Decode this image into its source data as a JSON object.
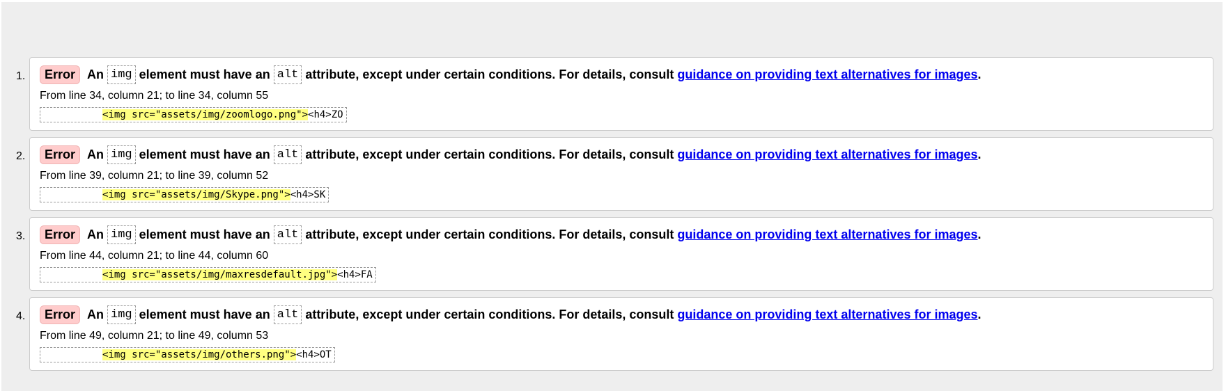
{
  "errors": [
    {
      "number": "1.",
      "badge": "Error",
      "t1": "An",
      "code1": "img",
      "t2": "element must have an",
      "code2": "alt",
      "t3": "attribute, except under certain conditions. For details, consult",
      "link": "guidance on providing text alternatives for images",
      "t4": ".",
      "location": "From line 34, column 21; to line 34, column 55",
      "highlight": "<img src=\"assets/img/zoomlogo.png\">",
      "after": "<h4>ZO"
    },
    {
      "number": "2.",
      "badge": "Error",
      "t1": "An",
      "code1": "img",
      "t2": "element must have an",
      "code2": "alt",
      "t3": "attribute, except under certain conditions. For details, consult",
      "link": "guidance on providing text alternatives for images",
      "t4": ".",
      "location": "From line 39, column 21; to line 39, column 52",
      "highlight": "<img src=\"assets/img/Skype.png\">",
      "after": "<h4>SK"
    },
    {
      "number": "3.",
      "badge": "Error",
      "t1": "An",
      "code1": "img",
      "t2": "element must have an",
      "code2": "alt",
      "t3": "attribute, except under certain conditions. For details, consult",
      "link": "guidance on providing text alternatives for images",
      "t4": ".",
      "location": "From line 44, column 21; to line 44, column 60",
      "highlight": "<img src=\"assets/img/maxresdefault.jpg\">",
      "after": "<h4>FA"
    },
    {
      "number": "4.",
      "badge": "Error",
      "t1": "An",
      "code1": "img",
      "t2": "element must have an",
      "code2": "alt",
      "t3": "attribute, except under certain conditions. For details, consult",
      "link": "guidance on providing text alternatives for images",
      "t4": ".",
      "location": "From line 49, column 21; to line 49, column 53",
      "highlight": "<img src=\"assets/img/others.png\">",
      "after": "<h4>OT"
    }
  ]
}
